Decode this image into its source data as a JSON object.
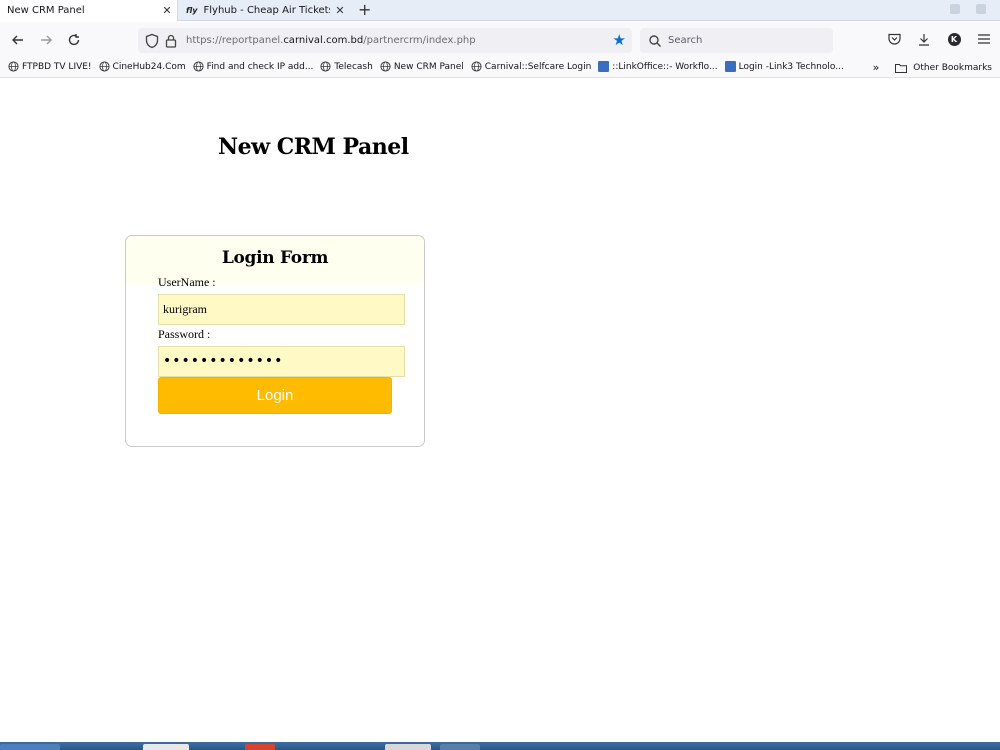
{
  "tabs": [
    {
      "label": "New CRM Panel",
      "active": true
    },
    {
      "label": "Flyhub - Cheap Air Tickets",
      "favicon_text": "fly",
      "active": false
    }
  ],
  "nav": {
    "url_prefix": "https://reportpanel.",
    "url_domain": "carnival.com.bd",
    "url_path": "/partnercrm/index.php",
    "search_placeholder": "Search",
    "account_initial": "K"
  },
  "bookmarks": [
    {
      "label": "FTPBD TV LIVE!",
      "icon": "globe-icon"
    },
    {
      "label": "CineHub24.Com",
      "icon": "globe-icon"
    },
    {
      "label": "Find and check IP add...",
      "icon": "globe-icon"
    },
    {
      "label": "Telecash",
      "icon": "globe-icon"
    },
    {
      "label": "New CRM Panel",
      "icon": "globe-icon"
    },
    {
      "label": "Carnival::Selfcare Login",
      "icon": "globe-icon"
    },
    {
      "label": "::LinkOffice::- Workflo...",
      "icon": "site-favicon"
    },
    {
      "label": "Login -Link3 Technolo...",
      "icon": "site-favicon"
    }
  ],
  "other_bookmarks": "Other Bookmarks",
  "page": {
    "title": "New CRM Panel",
    "form": {
      "title": "Login Form",
      "username_label": "UserName :",
      "username_value": "kurigram",
      "password_label": "Password :",
      "password_value": "•••••••••••••",
      "submit_label": "Login"
    }
  },
  "colors": {
    "accent_button": "#ffbb00",
    "input_background": "#fff9c6",
    "card_header": "#fffff0",
    "bookmark_star": "#0b6cda"
  }
}
